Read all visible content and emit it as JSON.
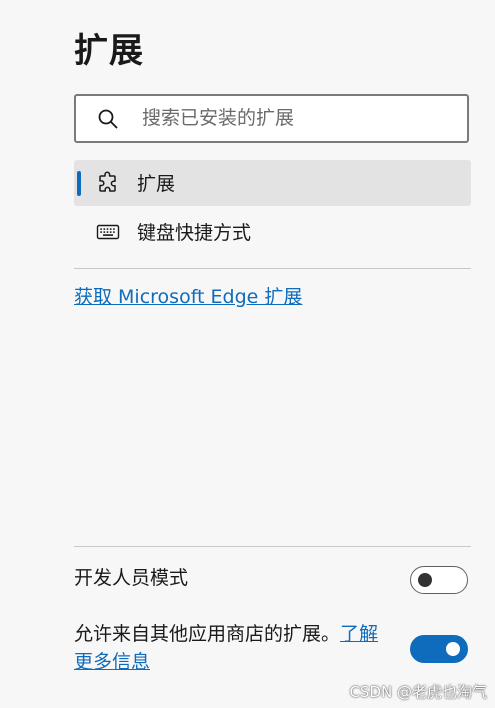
{
  "page": {
    "title": "扩展"
  },
  "search": {
    "placeholder": "搜索已安装的扩展",
    "value": "",
    "icon": "search-icon"
  },
  "nav": {
    "items": [
      {
        "label": "扩展",
        "icon": "puzzle-icon",
        "selected": true
      },
      {
        "label": "键盘快捷方式",
        "icon": "keyboard-icon",
        "selected": false
      }
    ]
  },
  "get_extensions_link": "获取 Microsoft Edge 扩展",
  "developer_mode": {
    "label": "开发人员模式",
    "enabled": false
  },
  "other_stores": {
    "text": "允许来自其他应用商店的扩展。",
    "link": "了解更多信息",
    "enabled": true
  },
  "colors": {
    "accent": "#0f6cbd",
    "background": "#f7f7f7",
    "selected_bg": "#e3e3e3"
  },
  "watermark": "CSDN @老虎也淘气"
}
